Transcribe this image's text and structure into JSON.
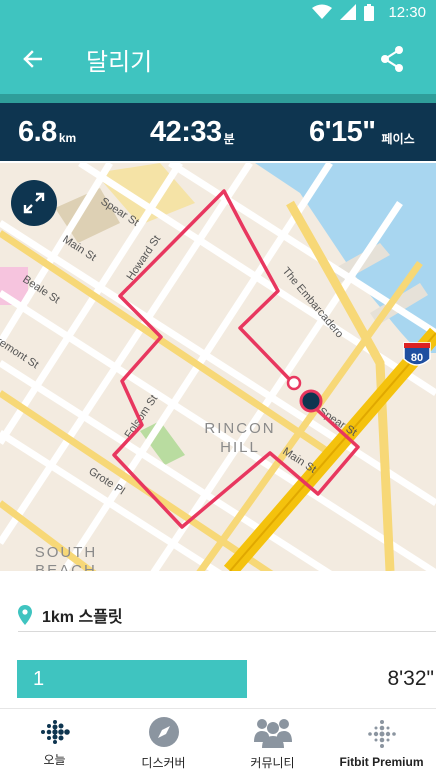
{
  "status_bar": {
    "time": "12:30",
    "icons": [
      "wifi-icon",
      "signal-icon",
      "battery-icon"
    ]
  },
  "app_bar": {
    "title": "달리기",
    "back_icon": "arrow-left-icon",
    "share_icon": "share-icon"
  },
  "stats": {
    "distance": {
      "value": "6.8",
      "unit": "km"
    },
    "duration": {
      "value": "42:33",
      "unit": "분"
    },
    "pace": {
      "value": "6'15\"",
      "unit": "페이스"
    }
  },
  "map": {
    "expand_icon": "expand-icon",
    "streets": [
      "Spear St",
      "Howard St",
      "Main St",
      "Beale St",
      "The Embarcadero",
      "Folsom St",
      "Grote Pl",
      "Spear St",
      "Main St",
      "Fremont St"
    ],
    "areas": {
      "rincon_1": "RINCON",
      "rincon_2": "HILL",
      "south_1": "SOUTH",
      "south_2": "BEACH"
    },
    "highway": "80",
    "colors": {
      "route": "#e8375f",
      "highway": "#f4c20d",
      "water": "#a8d6f0",
      "land": "#f3ebe0"
    }
  },
  "splits": {
    "icon": "location-pin-icon",
    "title": "1km 스플릿",
    "rows": [
      {
        "index": "1",
        "time": "8'32\"",
        "fraction": 0.55
      }
    ]
  },
  "bottom_nav": [
    {
      "label": "오늘",
      "icon": "fitbit-dots-icon",
      "active": true
    },
    {
      "label": "디스커버",
      "icon": "compass-icon",
      "active": false
    },
    {
      "label": "커뮤니티",
      "icon": "community-icon",
      "active": false
    },
    {
      "label": "Fitbit Premium",
      "icon": "premium-dots-icon",
      "active": false
    }
  ],
  "colors": {
    "accent": "#3fc4c0",
    "header_dark": "#0e3550"
  }
}
